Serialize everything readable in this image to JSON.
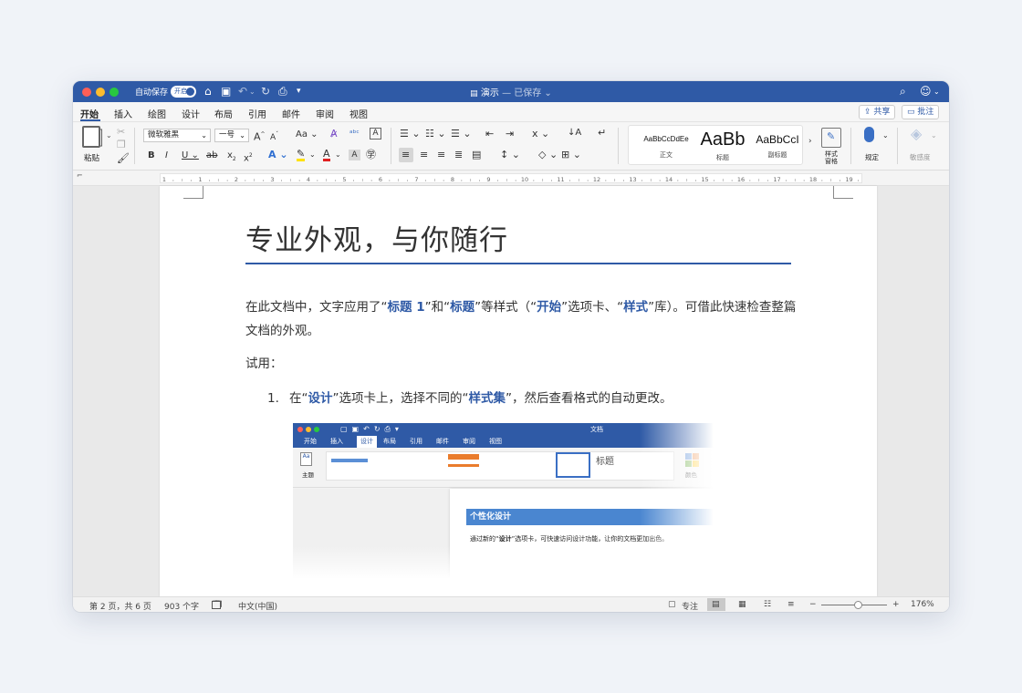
{
  "titlebar": {
    "autosave_label": "自动保存",
    "autosave_toggle": "开启",
    "doc_name": "演示",
    "saved_status": "— 已保存 ⌄"
  },
  "tabs": [
    "开始",
    "插入",
    "绘图",
    "设计",
    "布局",
    "引用",
    "邮件",
    "审阅",
    "视图"
  ],
  "share_label": "共享",
  "comments_label": "批注",
  "ribbon": {
    "paste_label": "粘贴",
    "font_name": "微软雅黑",
    "font_size": "一号",
    "case_label": "Aa",
    "styles": [
      {
        "sample": "AaBbCcDdEe",
        "label": "正文"
      },
      {
        "sample": "AaBb",
        "label": "标题"
      },
      {
        "sample": "AaBbCcI",
        "label": "副标题"
      }
    ],
    "styles_pane_label": "样式\n窗格",
    "dictate_label": "规定",
    "sensitivity_label": "敏感度"
  },
  "ruler_numbers": [
    "1",
    "1",
    "2",
    "3",
    "4",
    "5",
    "6",
    "7",
    "8",
    "9",
    "10",
    "11",
    "12",
    "13",
    "14",
    "15",
    "16",
    "17",
    "18",
    "19"
  ],
  "document": {
    "title": "专业外观，与你随行",
    "para1": [
      {
        "t": "在此文档中，文字应用了“",
        "b": false
      },
      {
        "t": "标题 1",
        "b": true
      },
      {
        "t": "”和“",
        "b": false
      },
      {
        "t": "标题",
        "b": true
      },
      {
        "t": "”等样式（“",
        "b": false
      },
      {
        "t": "开始",
        "b": true
      },
      {
        "t": "”选项卡、“",
        "b": false
      },
      {
        "t": "样式",
        "b": true
      },
      {
        "t": "”库）。可借此快速检查整篇文档的外观。",
        "b": false
      }
    ],
    "try_label": "试用：",
    "list_number": "1.",
    "list_item": [
      {
        "t": "在“",
        "b": false
      },
      {
        "t": "设计",
        "b": true
      },
      {
        "t": "”选项卡上，选择不同的“",
        "b": false
      },
      {
        "t": "样式集",
        "b": true
      },
      {
        "t": "”，然后查看格式的自动更改。",
        "b": false
      }
    ]
  },
  "embedded": {
    "doc_label": "文档",
    "tabs": [
      "开始",
      "插入",
      "设计",
      "布局",
      "引用",
      "邮件",
      "审阅",
      "视图"
    ],
    "theme_label": "主题",
    "heading_sample": "标题",
    "colors_label": "颜色",
    "doc_heading": "个性化设计",
    "doc_text_prefix": "通过新的“",
    "doc_text_bold": "设计",
    "doc_text_suffix": "”选项卡，可快速访问设计功能，让你的文档更加出色。"
  },
  "statusbar": {
    "page": "第 2 页，共 6 页",
    "words": "903 个字",
    "language": "中文(中国)",
    "focus": "专注",
    "zoom": "176%"
  }
}
